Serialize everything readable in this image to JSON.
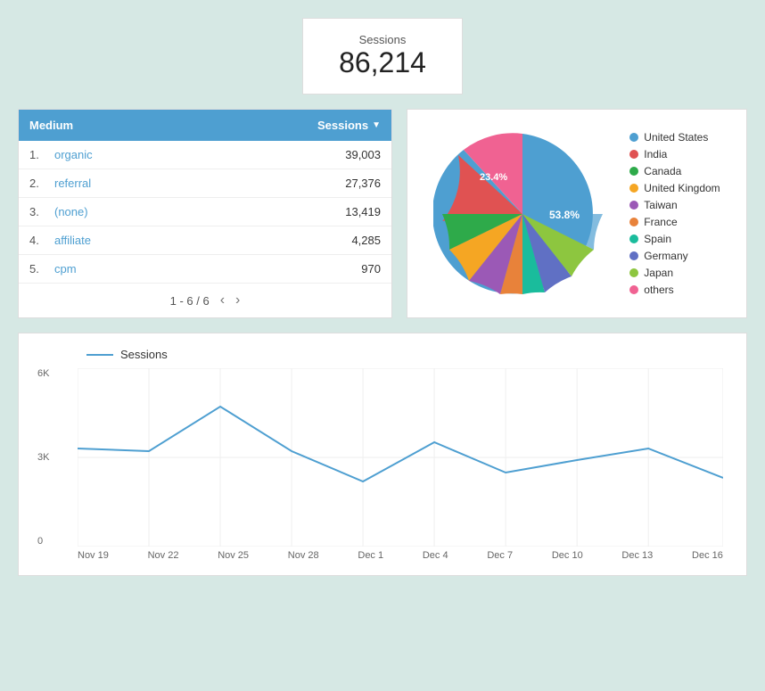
{
  "sessions_card": {
    "label": "Sessions",
    "value": "86,214"
  },
  "table": {
    "headers": {
      "medium": "Medium",
      "sessions": "Sessions",
      "sort_icon": "▼"
    },
    "rows": [
      {
        "num": "1.",
        "name": "organic",
        "value": "39,003"
      },
      {
        "num": "2.",
        "name": "referral",
        "value": "27,376"
      },
      {
        "num": "3.",
        "name": "(none)",
        "value": "13,419"
      },
      {
        "num": "4.",
        "name": "affiliate",
        "value": "4,285"
      },
      {
        "num": "5.",
        "name": "cpm",
        "value": "970"
      }
    ],
    "pagination": "1 - 6 / 6"
  },
  "pie": {
    "center_label": "53.8%",
    "slice_label": "23.4%",
    "legend": [
      {
        "label": "United States",
        "color": "#4e9fd1"
      },
      {
        "label": "India",
        "color": "#e05252"
      },
      {
        "label": "Canada",
        "color": "#2eaa4a"
      },
      {
        "label": "United Kingdom",
        "color": "#f5a623"
      },
      {
        "label": "Taiwan",
        "color": "#9b59b6"
      },
      {
        "label": "France",
        "color": "#e8823a"
      },
      {
        "label": "Spain",
        "color": "#1abc9c"
      },
      {
        "label": "Germany",
        "color": "#6070c4"
      },
      {
        "label": "Japan",
        "color": "#8dc63f"
      },
      {
        "label": "others",
        "color": "#f06292"
      }
    ]
  },
  "line_chart": {
    "title": "Sessions",
    "y_labels": [
      "0",
      "3K",
      "6K"
    ],
    "x_labels": [
      "Nov 19",
      "Nov 22",
      "Nov 25",
      "Nov 28",
      "Dec 1",
      "Dec 4",
      "Dec 7",
      "Dec 10",
      "Dec 13",
      "Dec 16"
    ]
  }
}
